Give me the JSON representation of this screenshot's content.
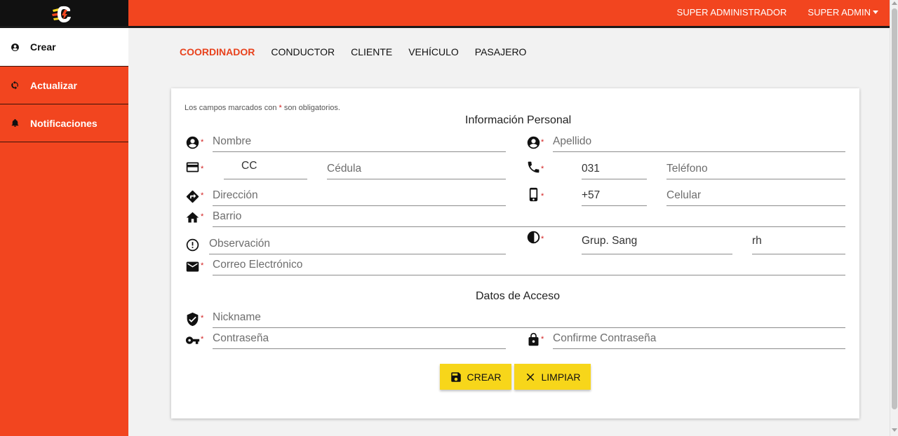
{
  "header": {
    "user_role": "SUPER ADMINISTRADOR",
    "user_menu": "SUPER ADMIN"
  },
  "sidebar": {
    "items": [
      {
        "label": "Crear",
        "icon": "account-circle-icon"
      },
      {
        "label": "Actualizar",
        "icon": "refresh-icon"
      },
      {
        "label": "Notificaciones",
        "icon": "bell-icon"
      }
    ]
  },
  "tabs": [
    "COORDINADOR",
    "CONDUCTOR",
    "CLIENTE",
    "VEHÍCULO",
    "PASAJERO"
  ],
  "form": {
    "note_prefix": "Los campos marcados con ",
    "note_star": "*",
    "note_suffix": " son obligatorios.",
    "section_personal": "Información Personal",
    "section_access": "Datos de Acceso",
    "required_mark": "*",
    "nombre_ph": "Nombre",
    "apellido_ph": "Apellido",
    "doc_type_value": "CC",
    "cedula_ph": "Cédula",
    "tel_prefix_value": "031",
    "telefono_ph": "Teléfono",
    "direccion_ph": "Dirección",
    "cel_prefix_value": "+57",
    "celular_ph": "Celular",
    "barrio_ph": "Barrio",
    "observacion_ph": "Observación",
    "grupo_sang_ph": "Grup. Sang",
    "rh_ph": "rh",
    "correo_ph": "Correo Electrónico",
    "nickname_ph": "Nickname",
    "contrasena_ph": "Contraseña",
    "confirme_ph": "Confirme Contraseña",
    "crear_label": "CREAR",
    "limpiar_label": "LIMPIAR"
  },
  "colors": {
    "brand_orange": "#f2451f",
    "active_tab": "#e8421d",
    "button_yellow": "#f7d61a",
    "required_red": "#d32020"
  }
}
